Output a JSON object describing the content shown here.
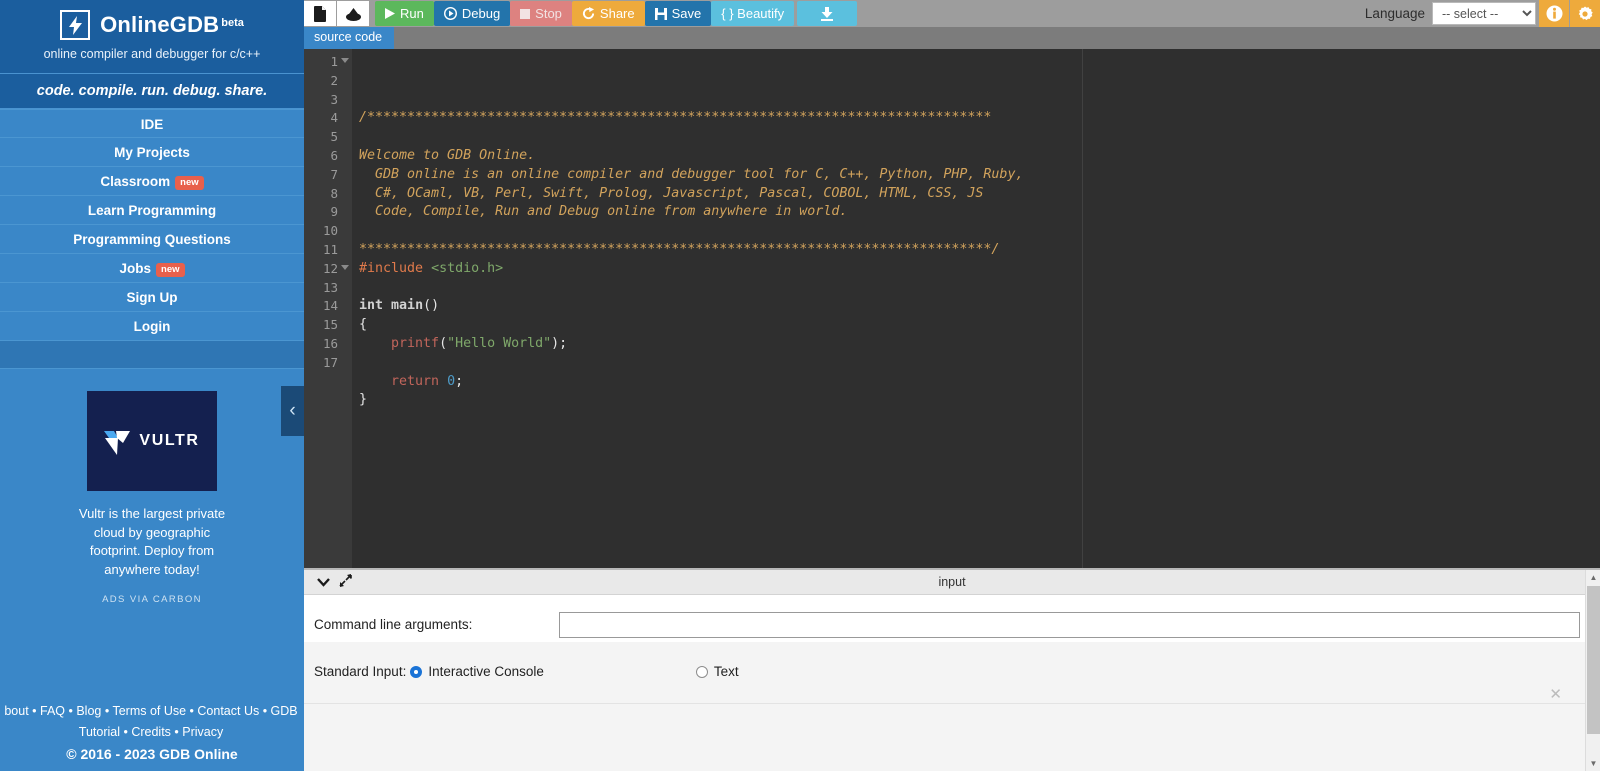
{
  "sidebar": {
    "brand": {
      "logo_icon": "lightning-bolt-icon",
      "name": "OnlineGDB",
      "beta": "beta",
      "tagline": "online compiler and debugger for c/c++"
    },
    "slogan": "code. compile. run. debug. share.",
    "nav": [
      {
        "label": "IDE",
        "badge": null
      },
      {
        "label": "My Projects",
        "badge": null
      },
      {
        "label": "Classroom",
        "badge": "new"
      },
      {
        "label": "Learn Programming",
        "badge": null
      },
      {
        "label": "Programming Questions",
        "badge": null
      },
      {
        "label": "Jobs",
        "badge": "new"
      },
      {
        "label": "Sign Up",
        "badge": null
      },
      {
        "label": "Login",
        "badge": null
      }
    ],
    "ad": {
      "logo_word": "VULTR",
      "text": "Vultr is the largest private cloud by geographic footprint. Deploy from anywhere today!",
      "attribution": "ADS VIA CARBON"
    },
    "footer": {
      "links_line1": "bout • FAQ • Blog • Terms of Use • Contact Us • GDB",
      "links_line2": "Tutorial • Credits • Privacy",
      "copyright": "© 2016 - 2023 GDB Online"
    },
    "collapse_label": "‹"
  },
  "toolbar": {
    "new_file_label": "🗎",
    "upload_label": "⬈",
    "run_label": "Run",
    "debug_label": "Debug",
    "stop_label": "Stop",
    "share_label": "Share",
    "save_label": "Save",
    "beautify_label": "{ } Beautify",
    "download_label": "⬇",
    "language_label": "Language",
    "language_value": "-- select --",
    "info_label": "i",
    "settings_label": "⚙"
  },
  "tabs": [
    {
      "label": "source code",
      "active": true
    }
  ],
  "editor": {
    "print_margin_column": 80,
    "lines": [
      {
        "n": 1,
        "fold": true,
        "tokens": [
          {
            "t": "/******************************************************************************",
            "c": "comment"
          }
        ]
      },
      {
        "n": 2,
        "fold": false,
        "tokens": []
      },
      {
        "n": 3,
        "fold": false,
        "tokens": [
          {
            "t": "Welcome to GDB Online.",
            "c": "comment"
          }
        ]
      },
      {
        "n": 4,
        "fold": false,
        "tokens": [
          {
            "t": "  GDB online is an online compiler and debugger tool for C, C++, Python, PHP, Ruby,",
            "c": "comment"
          }
        ]
      },
      {
        "n": 5,
        "fold": false,
        "tokens": [
          {
            "t": "  C#, OCaml, VB, Perl, Swift, Prolog, Javascript, Pascal, COBOL, HTML, CSS, JS",
            "c": "comment"
          }
        ]
      },
      {
        "n": 6,
        "fold": false,
        "tokens": [
          {
            "t": "  Code, Compile, Run and Debug online from anywhere in world.",
            "c": "comment"
          }
        ]
      },
      {
        "n": 7,
        "fold": false,
        "tokens": []
      },
      {
        "n": 8,
        "fold": false,
        "tokens": [
          {
            "t": "*******************************************************************************/",
            "c": "comment"
          }
        ]
      },
      {
        "n": 9,
        "fold": false,
        "tokens": [
          {
            "t": "#include ",
            "c": "pre"
          },
          {
            "t": "<stdio.h>",
            "c": "string"
          }
        ]
      },
      {
        "n": 10,
        "fold": false,
        "tokens": []
      },
      {
        "n": 11,
        "fold": false,
        "tokens": [
          {
            "t": "int",
            "c": "kw"
          },
          {
            "t": " ",
            "c": "plain"
          },
          {
            "t": "main",
            "c": "kw"
          },
          {
            "t": "()",
            "c": "plain"
          }
        ]
      },
      {
        "n": 12,
        "fold": true,
        "tokens": [
          {
            "t": "{",
            "c": "plain"
          }
        ]
      },
      {
        "n": 13,
        "fold": false,
        "tokens": [
          {
            "t": "    ",
            "c": "plain"
          },
          {
            "t": "printf",
            "c": "fn"
          },
          {
            "t": "(",
            "c": "plain"
          },
          {
            "t": "\"Hello World\"",
            "c": "string"
          },
          {
            "t": ");",
            "c": "plain"
          }
        ]
      },
      {
        "n": 14,
        "fold": false,
        "tokens": []
      },
      {
        "n": 15,
        "fold": false,
        "tokens": [
          {
            "t": "    ",
            "c": "plain"
          },
          {
            "t": "return",
            "c": "fn"
          },
          {
            "t": " ",
            "c": "plain"
          },
          {
            "t": "0",
            "c": "num"
          },
          {
            "t": ";",
            "c": "plain"
          }
        ]
      },
      {
        "n": 16,
        "fold": false,
        "tokens": [
          {
            "t": "}",
            "c": "plain"
          }
        ]
      },
      {
        "n": 17,
        "fold": false,
        "tokens": []
      }
    ]
  },
  "panel": {
    "title": "input",
    "collapse_icon": "chevron-down-icon",
    "expand_icon": "expand-arrows-icon",
    "args_label": "Command line arguments:",
    "args_value": "",
    "args_placeholder": "",
    "stdin_label": "Standard Input:",
    "options": [
      {
        "label": "Interactive Console",
        "selected": true
      },
      {
        "label": "Text",
        "selected": false
      }
    ],
    "close_label": "✕"
  },
  "colors": {
    "sidebar_bg": "#3a87c8",
    "sidebar_dark": "#1b5e9e",
    "accent_orange": "#eeaa3c",
    "run_green": "#5cb85c",
    "debug_blue": "#2374ab",
    "stop_red": "#dd8280",
    "beautify_cyan": "#5bc0de",
    "badge_red": "#e8604c",
    "editor_bg": "#2f2f2f",
    "comment": "#d2a35c",
    "string": "#7fa86a",
    "preprocessor": "#e07a4b",
    "number": "#4e9bc7"
  }
}
